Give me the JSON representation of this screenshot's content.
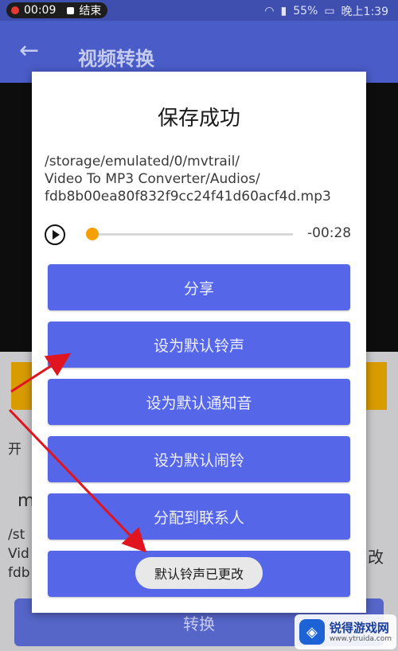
{
  "status_bar": {
    "record_time": "00:09",
    "stop_label": "结束",
    "battery": "55%",
    "clock": "晚上1:39"
  },
  "app_bar": {
    "title": "视频转换"
  },
  "background": {
    "label_start": "开",
    "label_m": "m",
    "path_lines": [
      "/st",
      "Vid",
      "fdb"
    ],
    "label_right": "改",
    "convert_button": "转换"
  },
  "dialog": {
    "title": "保存成功",
    "path_lines": [
      "/storage/emulated/0/mvtrail/",
      "Video To MP3 Converter/Audios/",
      "fdb8b00ea80f832f9cc24f41d60acf4d.mp3"
    ],
    "player": {
      "remaining": "-00:28",
      "progress": 0
    },
    "buttons": {
      "share": "分享",
      "ringtone": "设为默认铃声",
      "notification": "设为默认通知音",
      "alarm": "设为默认闹铃",
      "contact": "分配到联系人"
    }
  },
  "toast": "默认铃声已更改",
  "watermark": {
    "name": "锐得游戏网",
    "url": "www.ytruida.com"
  },
  "colors": {
    "accent": "#5566e8",
    "appbar": "#4a5cc8",
    "seek_thumb": "#f5a000",
    "annotation": "#e0151f"
  }
}
